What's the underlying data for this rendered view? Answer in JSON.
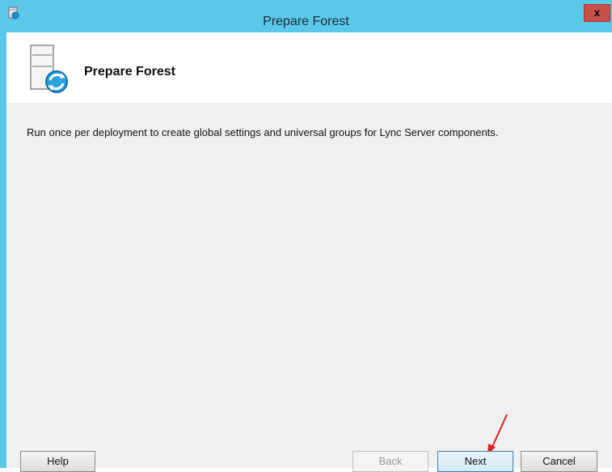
{
  "window": {
    "title": "Prepare Forest",
    "close_label": "x"
  },
  "header": {
    "title": "Prepare Forest"
  },
  "main": {
    "description": "Run once per deployment to create global settings and universal groups for Lync Server components."
  },
  "buttons": {
    "help": "Help",
    "back": "Back",
    "next": "Next",
    "cancel": "Cancel"
  },
  "colors": {
    "titlebar": "#5bc8ea",
    "close_button": "#c7504a",
    "annotation_arrow": "#e02020"
  },
  "icons": {
    "app": "server-setup-icon",
    "header": "server-refresh-icon",
    "annotation": "red-arrow-icon"
  }
}
